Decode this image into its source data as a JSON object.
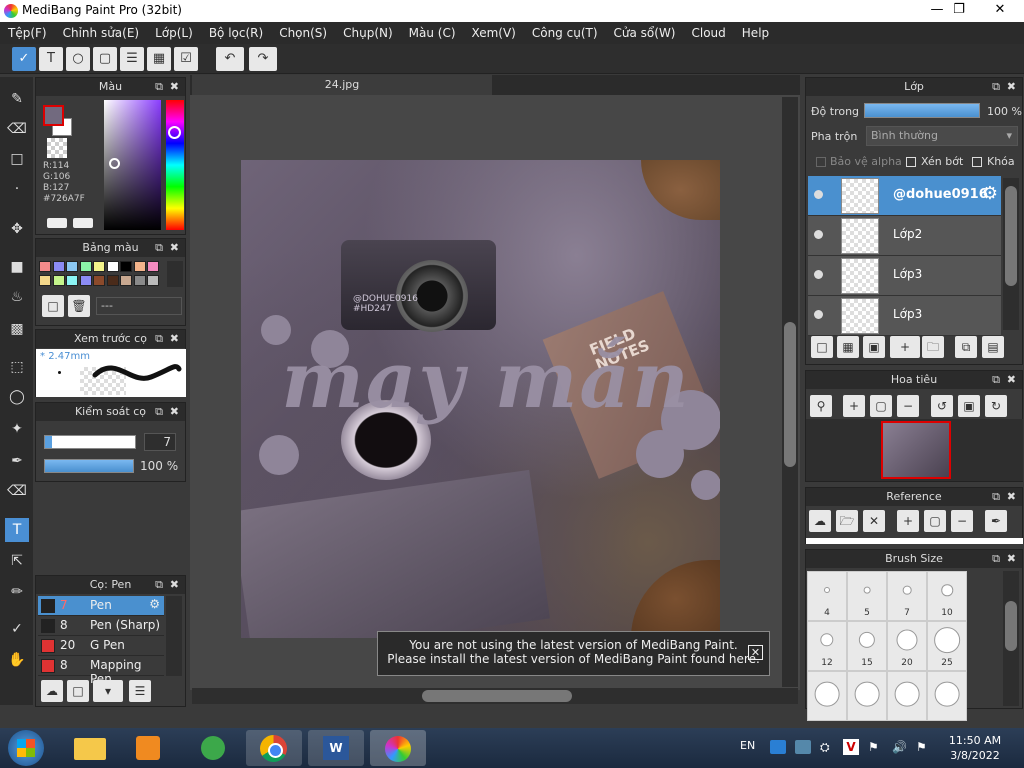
{
  "window": {
    "title": "MediBang Paint Pro (32bit)"
  },
  "menu": [
    "Tệp(F)",
    "Chỉnh sửa(E)",
    "Lớp(L)",
    "Bộ lọc(R)",
    "Chọn(S)",
    "Chụp(N)",
    "Màu (C)",
    "Xem(V)",
    "Công cụ(T)",
    "Cửa sổ(W)",
    "Cloud",
    "Help"
  ],
  "document": {
    "tab": "24.jpg"
  },
  "color_panel": {
    "title": "Màu",
    "r": "R:114",
    "g": "G:106",
    "b": "B:127",
    "hex": "#726A7F",
    "fg": "#726A7F",
    "bg": "#FFFFFF"
  },
  "palette_panel": {
    "title": "Bảng màu",
    "palette_name": "---",
    "swatches": [
      "#f48b8b",
      "#8b8bf4",
      "#8bc8f4",
      "#8bf4a8",
      "#f4f48b",
      "#ffffff",
      "#000000",
      "#f4b48b",
      "#f48bc0",
      "#f4d88b",
      "#c4f48b",
      "#8bf4f4",
      "#8b8bf4",
      "#8b4a2b",
      "#4a2b1a",
      "#c8a890",
      "#8a8a8a",
      "#bbbbbb"
    ]
  },
  "brush_preview": {
    "title": "Xem trước cọ",
    "size": "2.47mm"
  },
  "brush_control": {
    "title": "Kiểm soát cọ",
    "size_value": "7",
    "opacity_value": "100 %",
    "size_level": 0.08,
    "opacity_level": 1.0
  },
  "brush_list": {
    "title": "Cọ: Pen",
    "items": [
      {
        "size": "7",
        "name": "Pen",
        "color": "#222222",
        "selected": true
      },
      {
        "size": "8",
        "name": "Pen (Sharp)",
        "color": "#222222",
        "selected": false
      },
      {
        "size": "20",
        "name": "G Pen",
        "color": "#e03333",
        "selected": false
      },
      {
        "size": "8",
        "name": "Mapping Pen",
        "color": "#e03333",
        "selected": false
      }
    ]
  },
  "layer_panel": {
    "title": "Lớp",
    "opacity_label": "Độ trong",
    "opacity_value": "100 %",
    "opacity_level": 1.0,
    "blend_label": "Pha trộn",
    "blend_value": "Bình thường",
    "protect_alpha": "Bảo vệ alpha",
    "clipping": "Xén bớt",
    "lock": "Khóa",
    "layers": [
      {
        "name": "@dohue0916",
        "selected": true
      },
      {
        "name": "Lớp2",
        "selected": false
      },
      {
        "name": "Lớp3",
        "selected": false
      },
      {
        "name": "Lớp3",
        "selected": false
      }
    ]
  },
  "navigator_panel": {
    "title": "Hoa tiêu"
  },
  "reference_panel": {
    "title": "Reference"
  },
  "brush_size_panel": {
    "title": "Brush Size",
    "sizes": [
      "4",
      "5",
      "7",
      "10",
      "12",
      "15",
      "20",
      "25",
      "",
      "",
      "",
      ""
    ]
  },
  "artwork": {
    "overlay_text": "may mắn",
    "watermark": "@DOHUE0916\n#HD247",
    "notes_text": "FIELD\nNOTES"
  },
  "notice": {
    "line1": "You are not using the latest version of MediBang Paint.",
    "line2": "Please install the latest version of MediBang Paint found here."
  },
  "taskbar": {
    "lang": "EN",
    "time": "11:50 AM",
    "date": "3/8/2022"
  }
}
